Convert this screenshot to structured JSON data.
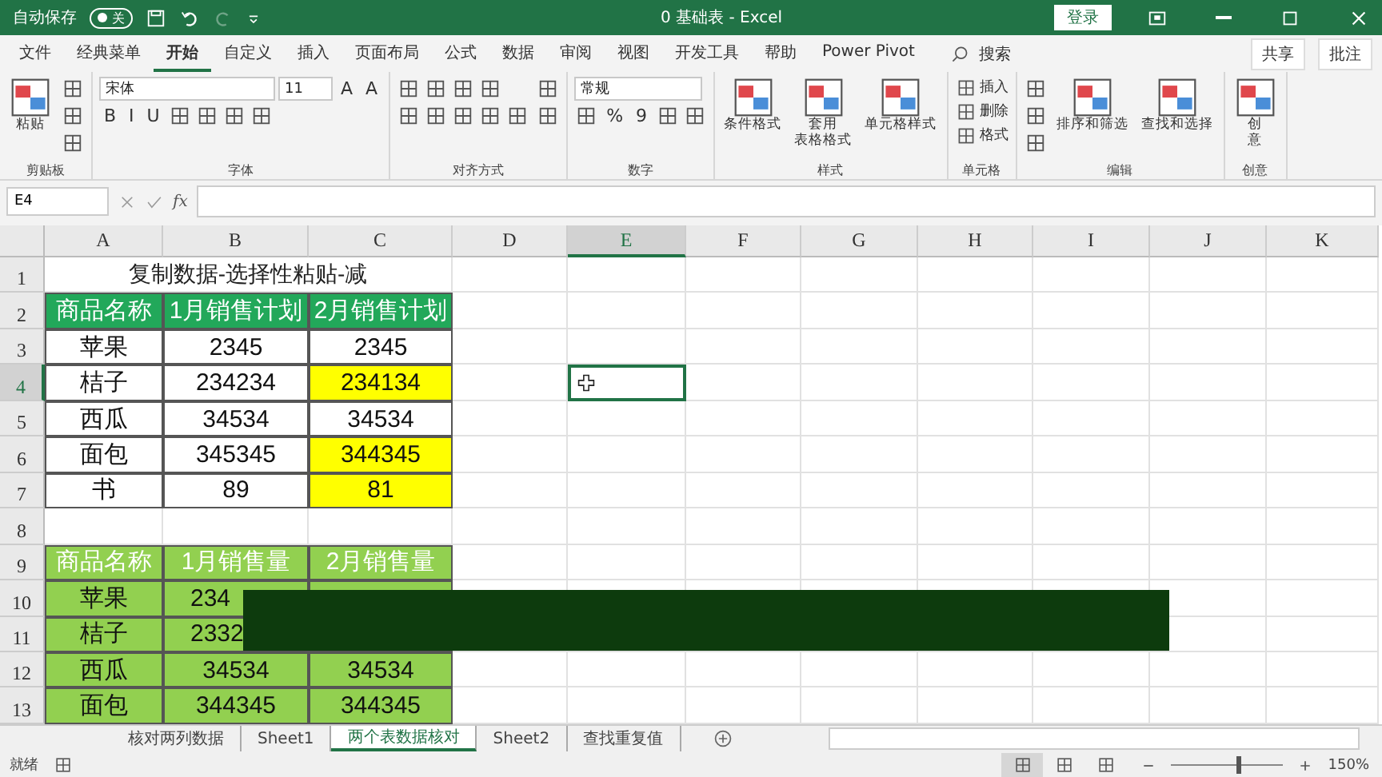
{
  "title_bar": {
    "autosave_label": "自动保存",
    "autosave_state": "关",
    "autosave_on": false,
    "title": "0 基础表 - Excel",
    "login": "登录"
  },
  "menu_tabs": [
    {
      "label": "文件",
      "selected": false
    },
    {
      "label": "经典菜单",
      "selected": false
    },
    {
      "label": "开始",
      "selected": true
    },
    {
      "label": "自定义",
      "selected": false
    },
    {
      "label": "插入",
      "selected": false
    },
    {
      "label": "页面布局",
      "selected": false
    },
    {
      "label": "公式",
      "selected": false
    },
    {
      "label": "数据",
      "selected": false
    },
    {
      "label": "审阅",
      "selected": false
    },
    {
      "label": "视图",
      "selected": false
    },
    {
      "label": "开发工具",
      "selected": false
    },
    {
      "label": "帮助",
      "selected": false
    },
    {
      "label": "Power Pivot",
      "selected": false
    }
  ],
  "search": "搜索",
  "share": "共享",
  "comment": "批注",
  "ribbon": [
    {
      "label": "剪贴板",
      "columns": [
        [
          [
            {
              "kind": "big",
              "lines": [
                "粘贴"
              ]
            }
          ]
        ],
        [
          [
            {
              "kind": "tool"
            }
          ],
          [
            {
              "kind": "tool"
            }
          ],
          [
            {
              "kind": "tool"
            }
          ]
        ]
      ]
    },
    {
      "label": "字体",
      "columns": [
        [
          [
            {
              "kind": "field",
              "text": "宋体"
            },
            {
              "kind": "field-small",
              "text": "11"
            },
            {
              "kind": "glyph",
              "text": "A"
            },
            {
              "kind": "glyph",
              "text": "A"
            }
          ],
          [
            {
              "kind": "glyph",
              "text": "B"
            },
            {
              "kind": "glyph",
              "text": "I"
            },
            {
              "kind": "glyph",
              "text": "U"
            },
            {
              "kind": "tool"
            },
            {
              "kind": "tool"
            },
            {
              "kind": "tool"
            },
            {
              "kind": "tool"
            }
          ]
        ]
      ]
    },
    {
      "label": "对齐方式",
      "columns": [
        [
          [
            {
              "kind": "tool"
            },
            {
              "kind": "tool"
            },
            {
              "kind": "tool"
            },
            {
              "kind": "tool"
            }
          ],
          [
            {
              "kind": "tool"
            },
            {
              "kind": "tool"
            },
            {
              "kind": "tool"
            },
            {
              "kind": "tool"
            },
            {
              "kind": "tool"
            }
          ]
        ],
        [
          [
            {
              "kind": "tool"
            }
          ],
          [
            {
              "kind": "tool"
            }
          ]
        ]
      ]
    },
    {
      "label": "数字",
      "columns": [
        [
          [
            {
              "kind": "field",
              "text": "常规"
            }
          ],
          [
            {
              "kind": "tool"
            },
            {
              "kind": "glyph",
              "text": "%"
            },
            {
              "kind": "glyph",
              "text": "9"
            },
            {
              "kind": "tool"
            },
            {
              "kind": "tool"
            }
          ]
        ]
      ]
    },
    {
      "label": "样式",
      "columns": [
        [
          [
            {
              "kind": "big",
              "lines": [
                "条件格式"
              ]
            }
          ]
        ],
        [
          [
            {
              "kind": "big",
              "lines": [
                "套用",
                "表格格式"
              ]
            }
          ]
        ],
        [
          [
            {
              "kind": "big",
              "lines": [
                "单元格样式"
              ]
            }
          ]
        ]
      ]
    },
    {
      "label": "单元格",
      "columns": [
        [
          [
            {
              "kind": "small",
              "text": "插入"
            }
          ],
          [
            {
              "kind": "small",
              "text": "删除"
            }
          ],
          [
            {
              "kind": "small",
              "text": "格式"
            }
          ]
        ]
      ]
    },
    {
      "label": "编辑",
      "columns": [
        [
          [
            {
              "kind": "tool"
            }
          ],
          [
            {
              "kind": "tool"
            }
          ],
          [
            {
              "kind": "tool"
            }
          ]
        ],
        [
          [
            {
              "kind": "big",
              "lines": [
                "排序和筛选"
              ]
            }
          ]
        ],
        [
          [
            {
              "kind": "big",
              "lines": [
                "查找和选择"
              ]
            }
          ]
        ]
      ]
    },
    {
      "label": "创意",
      "columns": [
        [
          [
            {
              "kind": "big",
              "lines": [
                "创",
                "意"
              ]
            }
          ]
        ]
      ]
    }
  ],
  "name_box": "E4",
  "function_label": "fx",
  "sheet": {
    "columns": [
      {
        "label": "A",
        "selected": false
      },
      {
        "label": "B",
        "selected": false
      },
      {
        "label": "C",
        "selected": false
      },
      {
        "label": "D",
        "selected": false
      },
      {
        "label": "E",
        "selected": true
      },
      {
        "label": "F",
        "selected": false
      },
      {
        "label": "G",
        "selected": false
      },
      {
        "label": "H",
        "selected": false
      },
      {
        "label": "I",
        "selected": false
      },
      {
        "label": "J",
        "selected": false
      },
      {
        "label": "K",
        "selected": false
      }
    ],
    "rows": [
      {
        "number": "1",
        "selected": false,
        "cells": [
          {
            "kind": "title",
            "text": "复制数据-选择性粘贴-减"
          }
        ]
      },
      {
        "number": "2",
        "selected": false,
        "cells": [
          {
            "kind": "head",
            "text": "商品名称"
          },
          {
            "kind": "head",
            "text": "1月销售计划"
          },
          {
            "kind": "head",
            "text": "2月销售计划"
          }
        ]
      },
      {
        "number": "3",
        "selected": false,
        "cells": [
          {
            "kind": "plain",
            "text": "苹果"
          },
          {
            "kind": "plain",
            "text": "2345"
          },
          {
            "kind": "plain",
            "text": "2345"
          }
        ]
      },
      {
        "number": "4",
        "selected": true,
        "cells": [
          {
            "kind": "plain",
            "text": "桔子"
          },
          {
            "kind": "plain",
            "text": "234234"
          },
          {
            "kind": "yellow",
            "text": "234134"
          }
        ]
      },
      {
        "number": "5",
        "selected": false,
        "cells": [
          {
            "kind": "plain",
            "text": "西瓜"
          },
          {
            "kind": "plain",
            "text": "34534"
          },
          {
            "kind": "plain",
            "text": "34534"
          }
        ]
      },
      {
        "number": "6",
        "selected": false,
        "cells": [
          {
            "kind": "plain",
            "text": "面包"
          },
          {
            "kind": "plain",
            "text": "345345"
          },
          {
            "kind": "yellow",
            "text": "344345"
          }
        ]
      },
      {
        "number": "7",
        "selected": false,
        "cells": [
          {
            "kind": "plain",
            "text": "书"
          },
          {
            "kind": "plain",
            "text": "89"
          },
          {
            "kind": "yellow",
            "text": "81"
          }
        ]
      },
      {
        "number": "8",
        "selected": false,
        "cells": []
      },
      {
        "number": "9",
        "selected": false,
        "cells": [
          {
            "kind": "head2",
            "text": "商品名称"
          },
          {
            "kind": "head2",
            "text": "1月销售量"
          },
          {
            "kind": "head2",
            "text": "2月销售量"
          }
        ]
      },
      {
        "number": "10",
        "selected": false,
        "cells": [
          {
            "kind": "data2",
            "text": "苹果"
          },
          {
            "kind": "cut",
            "text": "234"
          },
          {
            "kind": "data2"
          }
        ]
      },
      {
        "number": "11",
        "selected": false,
        "cells": [
          {
            "kind": "data2",
            "text": "桔子"
          },
          {
            "kind": "cut",
            "text": "2332"
          },
          {
            "kind": "data2"
          }
        ]
      },
      {
        "number": "12",
        "selected": false,
        "cells": [
          {
            "kind": "data2",
            "text": "西瓜"
          },
          {
            "kind": "data2",
            "text": "34534"
          },
          {
            "kind": "data2",
            "text": "34534"
          }
        ]
      },
      {
        "number": "13",
        "selected": false,
        "cells": [
          {
            "kind": "data2",
            "text": "面包"
          },
          {
            "kind": "data2",
            "text": "344345"
          },
          {
            "kind": "data2",
            "text": "344345"
          }
        ]
      }
    ],
    "overlay": {
      "kind": "caption-bar"
    }
  },
  "sheet_tabs": [
    {
      "label": "核对两列数据",
      "selected": false
    },
    {
      "label": "Sheet1",
      "selected": false
    },
    {
      "label": "两个表数据核对",
      "selected": true
    },
    {
      "label": "Sheet2",
      "selected": false
    },
    {
      "label": "查找重复值",
      "selected": false
    }
  ],
  "status": "就绪",
  "views": [
    {
      "selected": true
    },
    {
      "selected": false
    },
    {
      "selected": false
    }
  ],
  "zoom": {
    "level": 0.58,
    "text": "150%"
  }
}
